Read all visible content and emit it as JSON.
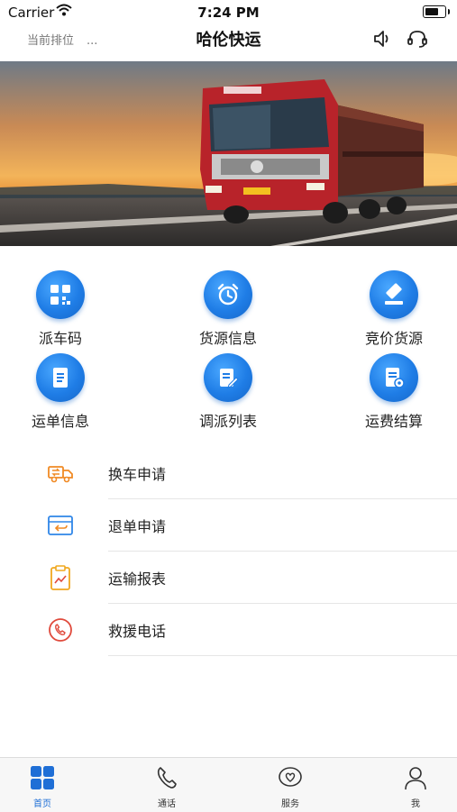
{
  "status_bar": {
    "carrier": "Carrier",
    "time": "7:24 PM"
  },
  "nav": {
    "queue_label": "当前排位",
    "queue_value": "...",
    "title": "哈伦快运"
  },
  "grid": [
    {
      "label": "派车码",
      "icon": "qr-code-icon"
    },
    {
      "label": "货源信息",
      "icon": "alarm-clock-icon"
    },
    {
      "label": "竞价货源",
      "icon": "gavel-icon"
    },
    {
      "label": "运单信息",
      "icon": "document-icon"
    },
    {
      "label": "调派列表",
      "icon": "edit-list-icon"
    },
    {
      "label": "运费结算",
      "icon": "settlement-icon"
    }
  ],
  "list": [
    {
      "label": "换车申请",
      "icon": "truck-swap-icon",
      "color": "#f08a24"
    },
    {
      "label": "退单申请",
      "icon": "return-order-icon",
      "color": "#2f86e8"
    },
    {
      "label": "运输报表",
      "icon": "report-clipboard-icon",
      "color": "#f0a81f"
    },
    {
      "label": "救援电话",
      "icon": "phone-icon",
      "color": "#e04a3c"
    }
  ],
  "tabs": [
    {
      "label": "首页",
      "icon": "home-grid-icon",
      "active": true
    },
    {
      "label": "通话",
      "icon": "phone-icon",
      "active": false
    },
    {
      "label": "服务",
      "icon": "heart-chat-icon",
      "active": false
    },
    {
      "label": "我",
      "icon": "person-icon",
      "active": false
    }
  ],
  "colors": {
    "accent": "#1f7de6",
    "active_tab": "#1f6fd6"
  }
}
